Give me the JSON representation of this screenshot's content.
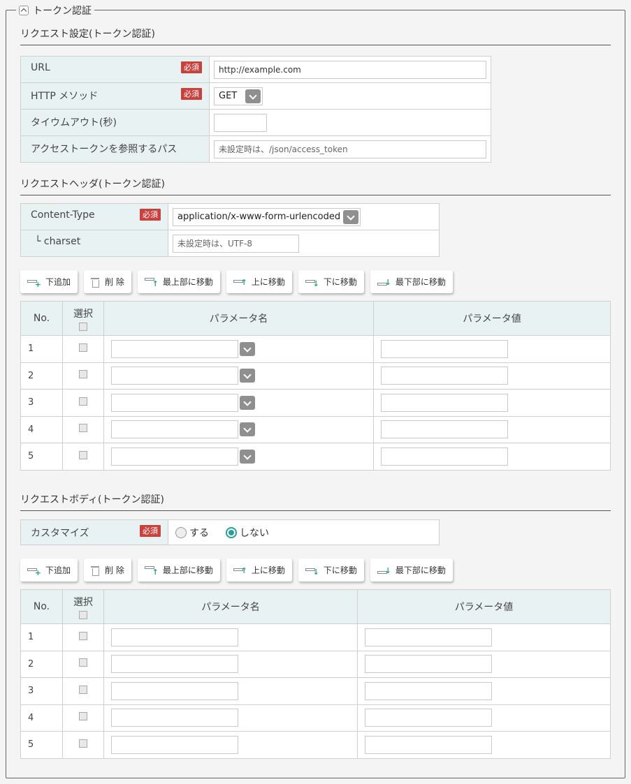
{
  "legend": {
    "label": "トークン認証",
    "toggle_icon": "chevron-up-icon"
  },
  "request_settings": {
    "title": "リクエスト設定(トークン認証)",
    "required_label": "必須",
    "url": {
      "label": "URL",
      "value": "http://example.com"
    },
    "method": {
      "label": "HTTP メソッド",
      "value": "GET"
    },
    "timeout": {
      "label": "タイウムアウト(秒)",
      "value": ""
    },
    "token_path": {
      "label": "アクセストークンを参照するパス",
      "placeholder": "未設定時は、/json/access_token"
    }
  },
  "request_header": {
    "title": "リクエストヘッダ(トークン認証)",
    "content_type": {
      "label": "Content-Type",
      "value": "application/x-www-form-urlencoded"
    },
    "charset": {
      "label": "└ charset",
      "placeholder": "未設定時は、UTF-8"
    }
  },
  "toolbar": {
    "add_below": "下追加",
    "delete": "削 除",
    "move_top": "最上部に移動",
    "move_up": "上に移動",
    "move_down": "下に移動",
    "move_bottom": "最下部に移動"
  },
  "param_table": {
    "col_no": "No.",
    "col_select": "選択",
    "col_name": "パラメータ名",
    "col_value": "パラメータ値",
    "rows": [
      "1",
      "2",
      "3",
      "4",
      "5"
    ]
  },
  "request_body": {
    "title": "リクエストボディ(トークン認証)",
    "customize": {
      "label": "カスタマイズ",
      "option_yes": "する",
      "option_no": "しない",
      "selected": "しない"
    }
  },
  "colors": {
    "accent": "#2a9d9d",
    "required_badge": "#c9403c",
    "label_bg": "#e9f2f2"
  }
}
